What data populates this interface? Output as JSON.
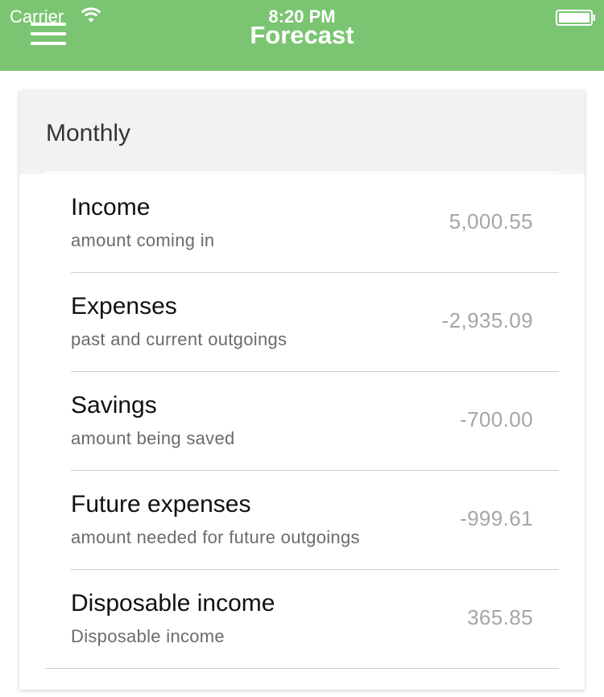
{
  "status_bar": {
    "carrier": "Carrier",
    "time": "8:20 PM",
    "wifi_icon": "wifi-icon",
    "battery_icon": "battery-icon"
  },
  "nav": {
    "title": "Forecast",
    "menu_icon": "hamburger-menu-icon",
    "background": "#7bc572"
  },
  "card": {
    "title": "Monthly",
    "rows": [
      {
        "title": "Income",
        "subtitle": "amount coming in",
        "value": "5,000.55"
      },
      {
        "title": "Expenses",
        "subtitle": "past and current outgoings",
        "value": "-2,935.09"
      },
      {
        "title": "Savings",
        "subtitle": "amount being saved",
        "value": "-700.00"
      },
      {
        "title": "Future expenses",
        "subtitle": "amount needed for future outgoings",
        "value": "-999.61"
      },
      {
        "title": "Disposable income",
        "subtitle": "Disposable income",
        "value": "365.85"
      }
    ]
  }
}
